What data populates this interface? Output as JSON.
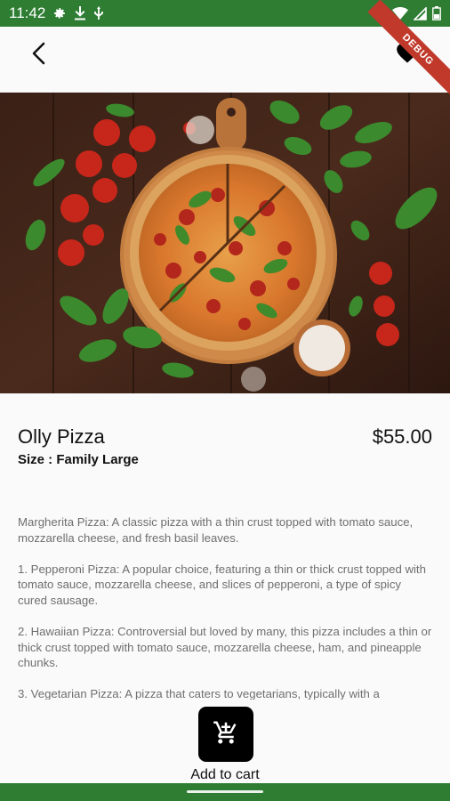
{
  "status_bar": {
    "time": "11:42",
    "icons": [
      "gear-icon",
      "download-icon",
      "usb-icon",
      "wifi-icon",
      "signal-icon",
      "battery-icon"
    ]
  },
  "debug_banner": "DEBUG",
  "app_bar": {
    "back_icon": "chevron-left-icon",
    "favorite_icon": "heart-filled-icon"
  },
  "product": {
    "image": "pizza-on-wooden-board",
    "name": "Olly Pizza",
    "price": "$55.00",
    "size": "Size : Family Large",
    "description": [
      "Margherita Pizza: A classic pizza with a thin crust topped with tomato sauce, mozzarella cheese, and fresh basil leaves.",
      "1. Pepperoni Pizza: A popular choice, featuring a thin or thick crust topped with tomato sauce, mozzarella cheese, and slices of pepperoni, a type of spicy cured sausage.",
      "2. Hawaiian Pizza: Controversial but loved by many, this pizza includes a thin or thick crust topped with tomato sauce, mozzarella cheese, ham, and pineapple chunks.",
      "3. Vegetarian Pizza: A pizza that caters to vegetarians, typically with a"
    ]
  },
  "cart": {
    "icon": "cart-icon",
    "label": "Add to cart"
  },
  "colors": {
    "status_bar": "#2e7d32",
    "background": "#fafafa",
    "cart_button": "#000000",
    "debug_ribbon": "#c0392b"
  }
}
